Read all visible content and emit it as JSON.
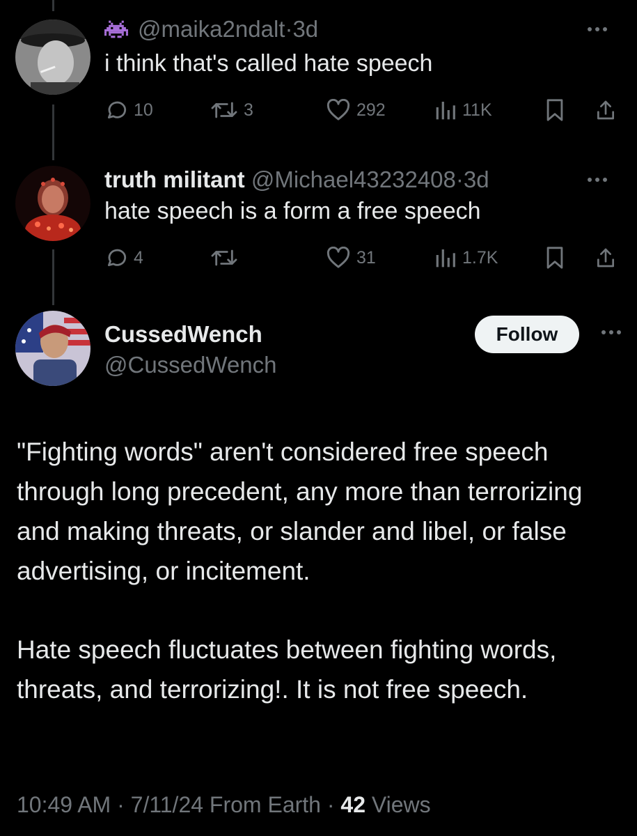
{
  "replies": [
    {
      "display_name": "",
      "handle": "@maika2ndalt",
      "time": "3d",
      "text": "i think that's called hate speech",
      "stats": {
        "replies": "10",
        "reposts": "3",
        "likes": "292",
        "views": "11K"
      }
    },
    {
      "display_name": "truth militant",
      "handle": "@Michael43232408",
      "time": "3d",
      "text": "hate speech is a form a free speech",
      "stats": {
        "replies": "4",
        "reposts": "",
        "likes": "31",
        "views": "1.7K"
      }
    }
  ],
  "main_post": {
    "display_name": "CussedWench",
    "handle": "@CussedWench",
    "follow_label": "Follow",
    "paragraphs": [
      "\"Fighting words\" aren't considered free speech through long precedent, any more than terrorizing and making threats, or slander and libel, or false advertising, or incitement.",
      "Hate speech fluctuates between fighting words, threats, and terrorizing!. It is not free speech."
    ],
    "time": "10:49 AM",
    "date": "7/11/24",
    "source": "From Earth",
    "views_count": "42",
    "views_label": "Views"
  },
  "separator": "·",
  "colors": {
    "background": "#000000",
    "text_primary": "#e7e9ea",
    "text_secondary": "#71767b",
    "thread_line": "#333639",
    "follow_button_bg": "#eff3f4",
    "alien_emoji": "#a86fd9"
  },
  "icons": {
    "alien": "alien-monster-emoji",
    "reply": "speech-bubble-icon",
    "repost": "repost-arrows-icon",
    "like": "heart-icon",
    "views": "bar-chart-icon",
    "bookmark": "bookmark-icon",
    "share": "share-icon",
    "more": "more-dots-icon"
  }
}
